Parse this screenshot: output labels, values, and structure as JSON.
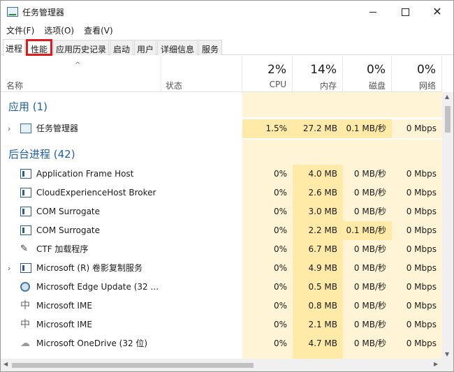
{
  "window": {
    "title": "任务管理器"
  },
  "menu": [
    "文件(F)",
    "选项(O)",
    "查看(V)"
  ],
  "tabs": [
    "进程",
    "性能",
    "应用历史记录",
    "启动",
    "用户",
    "详细信息",
    "服务"
  ],
  "header": {
    "name": "名称",
    "status": "状态",
    "cpu": {
      "pct": "2%",
      "label": "CPU"
    },
    "memory": {
      "pct": "14%",
      "label": "内存"
    },
    "disk": {
      "pct": "0%",
      "label": "磁盘"
    },
    "network": {
      "pct": "0%",
      "label": "网络"
    }
  },
  "groups": {
    "apps": "应用 (1)",
    "background": "后台进程 (42)"
  },
  "apps": [
    {
      "name": "任务管理器",
      "icon": "task-manager-icon",
      "cpu": "1.5%",
      "mem": "27.2 MB",
      "disk": "0.1 MB/秒",
      "net": "0 Mbps"
    }
  ],
  "background": [
    {
      "name": "Application Frame Host",
      "icon": "window-icon",
      "cpu": "0%",
      "mem": "4.0 MB",
      "disk": "0 MB/秒",
      "net": "0 Mbps"
    },
    {
      "name": "CloudExperienceHost Broker",
      "icon": "window-icon",
      "cpu": "0%",
      "mem": "2.6 MB",
      "disk": "0 MB/秒",
      "net": "0 Mbps"
    },
    {
      "name": "COM Surrogate",
      "icon": "window-icon",
      "cpu": "0%",
      "mem": "3.0 MB",
      "disk": "0 MB/秒",
      "net": "0 Mbps"
    },
    {
      "name": "COM Surrogate",
      "icon": "window-icon",
      "cpu": "0%",
      "mem": "2.2 MB",
      "disk": "0.1 MB/秒",
      "net": "0 Mbps"
    },
    {
      "name": "CTF 加载程序",
      "icon": "ctf-icon",
      "cpu": "0%",
      "mem": "6.7 MB",
      "disk": "0 MB/秒",
      "net": "0 Mbps"
    },
    {
      "name": "Microsoft (R) 卷影复制服务",
      "icon": "window-icon",
      "cpu": "0%",
      "mem": "4.9 MB",
      "disk": "0 MB/秒",
      "net": "0 Mbps"
    },
    {
      "name": "Microsoft Edge Update (32 ...",
      "icon": "edge-update-icon",
      "cpu": "0%",
      "mem": "0.5 MB",
      "disk": "0 MB/秒",
      "net": "0 Mbps"
    },
    {
      "name": "Microsoft IME",
      "icon": "ime-icon",
      "cpu": "0%",
      "mem": "0.8 MB",
      "disk": "0 MB/秒",
      "net": "0 Mbps"
    },
    {
      "name": "Microsoft IME",
      "icon": "ime-icon",
      "cpu": "0%",
      "mem": "2.1 MB",
      "disk": "0 MB/秒",
      "net": "0 Mbps"
    },
    {
      "name": "Microsoft OneDrive (32 位)",
      "icon": "onedrive-icon",
      "cpu": "0%",
      "mem": "4.7 MB",
      "disk": "0 MB/秒",
      "net": "0 Mbps"
    }
  ],
  "colors": {
    "highlight_box": "#e01b1b",
    "group_label": "#1f5fa8",
    "column_light": "#fff4d6",
    "column_mid": "#ffeaa8"
  }
}
